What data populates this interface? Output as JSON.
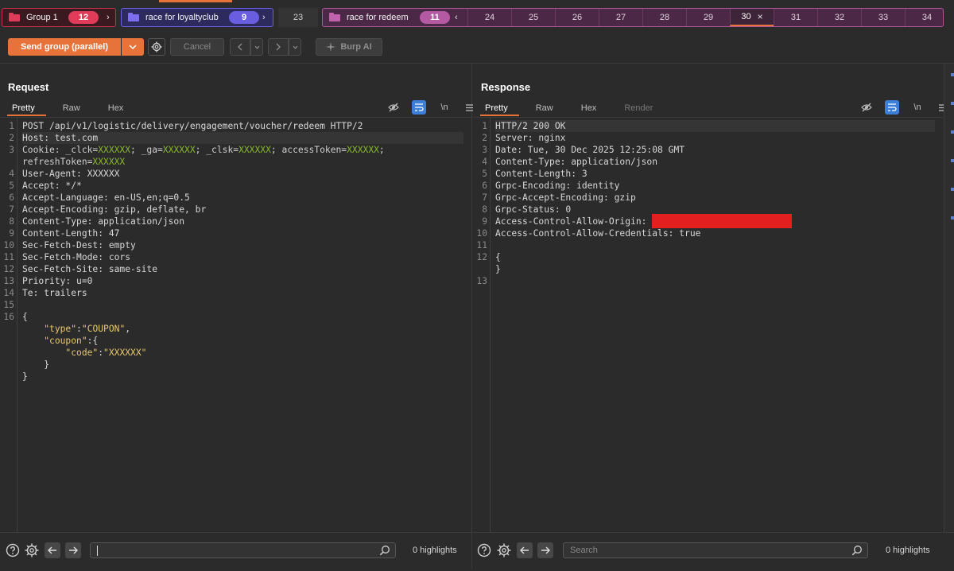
{
  "tab_groups": [
    {
      "label": "Group 1",
      "count": "12"
    },
    {
      "label": "race for loyaltyclub",
      "count": "9"
    },
    {
      "label": "race for redeem",
      "count": "11"
    }
  ],
  "standalone_tab": "23",
  "redeem_tabs": [
    "24",
    "25",
    "26",
    "27",
    "28",
    "29",
    "30",
    "31",
    "32",
    "33",
    "34"
  ],
  "active_tab": "30",
  "toolbar": {
    "send_label": "Send group (parallel)",
    "cancel_label": "Cancel",
    "burp_ai_label": "Burp AI"
  },
  "request": {
    "title": "Request",
    "tabs": [
      "Pretty",
      "Raw",
      "Hex"
    ],
    "lines": [
      {
        "n": "1",
        "text": "POST /api/v1/logistic/delivery/engagement/voucher/redeem HTTP/2"
      },
      {
        "n": "2",
        "text": "Host: test.com"
      },
      {
        "n": "3",
        "text": "Cookie: _clck=XXXXXX; _ga=XXXXXX; _clsk=XXXXXX; accessToken=XXXXXX;"
      },
      {
        "n": "",
        "text": "refreshToken=XXXXXX"
      },
      {
        "n": "4",
        "text": "User-Agent: XXXXXX"
      },
      {
        "n": "5",
        "text": "Accept: */*"
      },
      {
        "n": "6",
        "text": "Accept-Language: en-US,en;q=0.5"
      },
      {
        "n": "7",
        "text": "Accept-Encoding: gzip, deflate, br"
      },
      {
        "n": "8",
        "text": "Content-Type: application/json"
      },
      {
        "n": "9",
        "text": "Content-Length: 47"
      },
      {
        "n": "10",
        "text": "Sec-Fetch-Dest: empty"
      },
      {
        "n": "11",
        "text": "Sec-Fetch-Mode: cors"
      },
      {
        "n": "12",
        "text": "Sec-Fetch-Site: same-site"
      },
      {
        "n": "13",
        "text": "Priority: u=0"
      },
      {
        "n": "14",
        "text": "Te: trailers"
      },
      {
        "n": "15",
        "text": ""
      },
      {
        "n": "16",
        "text": "{"
      },
      {
        "n": "",
        "text": "    \"type\":\"COUPON\","
      },
      {
        "n": "",
        "text": "    \"coupon\":{"
      },
      {
        "n": "",
        "text": "        \"code\":\"XXXXXX\""
      },
      {
        "n": "",
        "text": "    }"
      },
      {
        "n": "",
        "text": "}"
      }
    ],
    "highlights_label": "0 highlights",
    "search_value": ""
  },
  "response": {
    "title": "Response",
    "tabs": [
      "Pretty",
      "Raw",
      "Hex",
      "Render"
    ],
    "lines": [
      {
        "n": "1",
        "text": "HTTP/2 200 OK"
      },
      {
        "n": "2",
        "text": "Server: nginx"
      },
      {
        "n": "3",
        "text": "Date: Tue, 30 Dec 2025 12:25:08 GMT"
      },
      {
        "n": "4",
        "text": "Content-Type: application/json"
      },
      {
        "n": "5",
        "text": "Content-Length: 3"
      },
      {
        "n": "6",
        "text": "Grpc-Encoding: identity"
      },
      {
        "n": "7",
        "text": "Grpc-Accept-Encoding: gzip"
      },
      {
        "n": "8",
        "text": "Grpc-Status: 0"
      },
      {
        "n": "9",
        "text": "Access-Control-Allow-Origin: "
      },
      {
        "n": "10",
        "text": "Access-Control-Allow-Credentials: true"
      },
      {
        "n": "11",
        "text": ""
      },
      {
        "n": "12",
        "text": "{"
      },
      {
        "n": "",
        "text": "}"
      },
      {
        "n": "13",
        "text": ""
      }
    ],
    "highlights_label": "0 highlights",
    "search_placeholder": "Search"
  },
  "colors": {
    "accent": "#e8733a",
    "group1": "#e03c5a",
    "group2": "#6a5ee0",
    "group3": "#b45aa3",
    "redaction": "#e31f1f"
  }
}
